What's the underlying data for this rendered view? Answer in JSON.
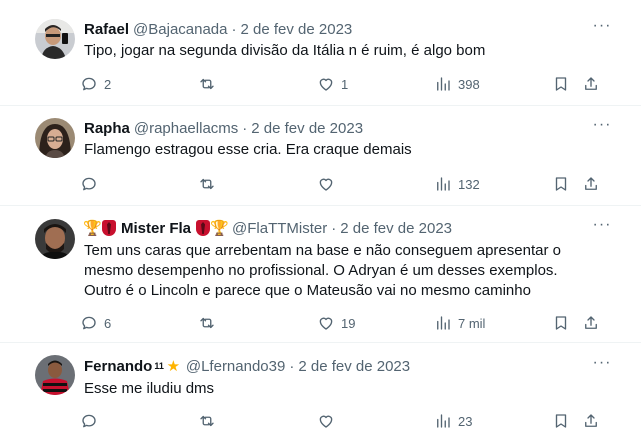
{
  "tweets": [
    {
      "name": "Rafael",
      "handle": "@Bajacanada",
      "dot": "·",
      "date": "2 de fev de 2023",
      "text": "Tipo, jogar na segunda divisão da Itália n é ruim, é algo bom",
      "replies": "2",
      "retweets": "",
      "likes": "1",
      "views": "398"
    },
    {
      "name": "Rapha",
      "handle": "@raphaellacms",
      "dot": "·",
      "date": "2 de fev de 2023",
      "text": "Flamengo estragou esse cria. Era craque demais",
      "replies": "",
      "retweets": "",
      "likes": "",
      "views": "132"
    },
    {
      "name": "Mister Fla",
      "handle": "@FlaTTMister",
      "dot": "·",
      "date": "2 de fev de 2023",
      "text_lines": [
        "Tem uns caras que arrebentam na base e não conseguem apresentar o",
        "mesmo desempenho no profissional. O Adryan é um desses exemplos.",
        "Outro é o Lincoln e parece que o Mateusão vai no mesmo caminho"
      ],
      "replies": "6",
      "retweets": "",
      "likes": "19",
      "views": "7 mil"
    },
    {
      "name": "Fernando",
      "name_sup": "11",
      "handle": "@Lfernando39",
      "dot": "·",
      "date": "2 de fev de 2023",
      "text": "Esse me iludiu dms",
      "replies": "",
      "retweets": "",
      "likes": "",
      "views": "23"
    }
  ],
  "icons": {
    "more": "more-horizontal-icon",
    "reply": "reply-icon",
    "retweet": "retweet-icon",
    "like": "heart-icon",
    "views": "views-icon",
    "bookmark": "bookmark-icon",
    "share": "share-icon",
    "trophy": "trophy-emoji-icon",
    "tie": "red-tie-emoji-icon",
    "star": "star-emoji-icon"
  },
  "colors": {
    "text": "#0f1419",
    "secondary": "#536471",
    "divider": "#eff3f4"
  }
}
